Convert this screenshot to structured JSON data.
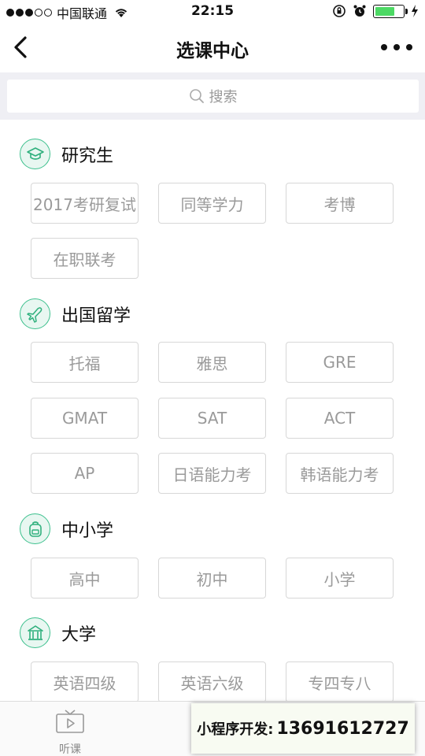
{
  "status_bar": {
    "carrier": "中国联通",
    "time": "22:15",
    "battery_level": 0.7
  },
  "nav": {
    "title": "选课中心"
  },
  "search": {
    "placeholder": "搜索"
  },
  "sections": [
    {
      "title": "研究生",
      "icon": "graduation-cap-icon",
      "items": [
        "2017考研复试",
        "同等学力",
        "考博",
        "在职联考"
      ]
    },
    {
      "title": "出国留学",
      "icon": "airplane-icon",
      "items": [
        "托福",
        "雅思",
        "GRE",
        "GMAT",
        "SAT",
        "ACT",
        "AP",
        "日语能力考",
        "韩语能力考"
      ]
    },
    {
      "title": "中小学",
      "icon": "backpack-icon",
      "items": [
        "高中",
        "初中",
        "小学"
      ]
    },
    {
      "title": "大学",
      "icon": "university-building-icon",
      "items": [
        "英语四级",
        "英语六级",
        "专四专八"
      ]
    }
  ],
  "tab_bar": {
    "tabs": [
      {
        "label": "听课",
        "icon": "tv-play-icon"
      }
    ]
  },
  "overlay": {
    "label": "小程序开发:",
    "number": "13691612727"
  },
  "colors": {
    "accent": "#3cc08d",
    "tag_border": "#d7d7d7",
    "tag_text": "#9a9a9a"
  }
}
